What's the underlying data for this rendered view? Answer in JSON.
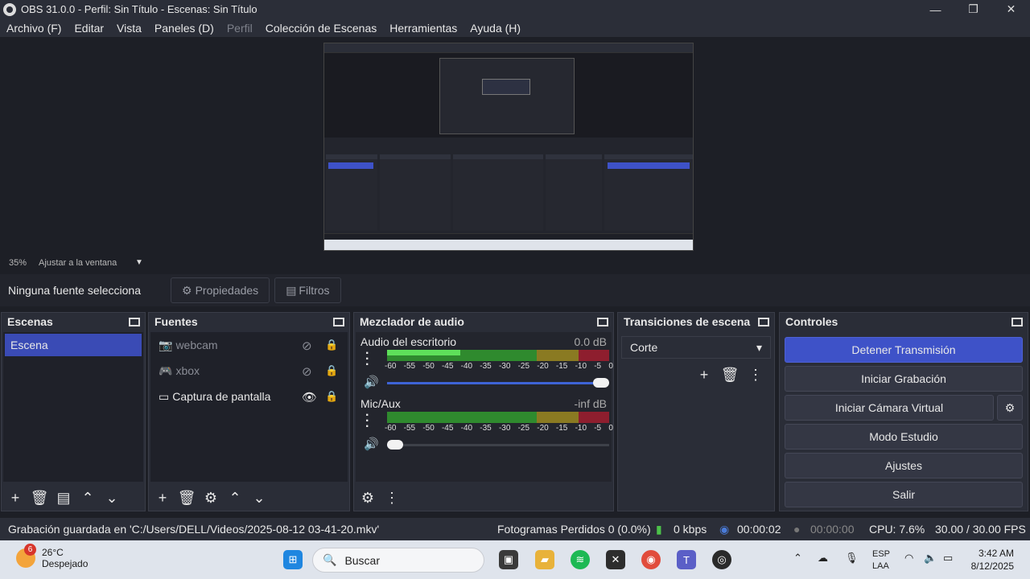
{
  "window": {
    "title": "OBS 31.0.0 - Perfil: Sin Título - Escenas: Sin Título",
    "min": "—",
    "max": "❐",
    "close": "✕"
  },
  "menu": [
    "Archivo (F)",
    "Editar",
    "Vista",
    "Paneles (D)",
    "Perfil",
    "Colección de Escenas",
    "Herramientas",
    "Ayuda (H)"
  ],
  "zoom": {
    "percent": "35%",
    "fit_label": "Ajustar a la ventana"
  },
  "selection": {
    "none_label": "Ninguna fuente selecciona",
    "properties": "Propiedades",
    "filters": "Filtros"
  },
  "scenes": {
    "title": "Escenas",
    "items": [
      "Escena"
    ]
  },
  "sources": {
    "title": "Fuentes",
    "items": [
      {
        "name": "webcam",
        "visible": false
      },
      {
        "name": "xbox",
        "visible": false
      },
      {
        "name": "Captura de pantalla",
        "visible": true
      }
    ]
  },
  "mixer": {
    "title": "Mezclador de audio",
    "channels": [
      {
        "name": "Audio del escritorio",
        "db": "0.0 dB",
        "level": 0.33,
        "volume": 0.97
      },
      {
        "name": "Mic/Aux",
        "db": "-inf dB",
        "level": 0,
        "volume": 0.03
      }
    ],
    "ticks": [
      "-60",
      "-55",
      "-50",
      "-45",
      "-40",
      "-35",
      "-30",
      "-25",
      "-20",
      "-15",
      "-10",
      "-5",
      "0"
    ]
  },
  "transitions": {
    "title": "Transiciones de escena",
    "selected": "Corte"
  },
  "controls": {
    "title": "Controles",
    "buttons": [
      "Detener Transmisión",
      "Iniciar Grabación",
      "Iniciar Cámara Virtual",
      "Modo Estudio",
      "Ajustes",
      "Salir"
    ]
  },
  "status": {
    "recording_saved": "Grabación guardada en 'C:/Users/DELL/Videos/2025-08-12 03-41-20.mkv'",
    "dropped": "Fotogramas Perdidos 0 (0.0%)",
    "bitrate": "0 kbps",
    "stream_time": "00:00:02",
    "rec_time": "00:00:00",
    "cpu": "CPU: 7.6%",
    "fps": "30.00 / 30.00 FPS"
  },
  "taskbar": {
    "weather_temp": "26°C",
    "weather_desc": "Despejado",
    "badge": "6",
    "search_placeholder": "Buscar",
    "lang_top": "ESP",
    "lang_bottom": "LAA",
    "time": "3:42 AM",
    "date": "8/12/2025"
  },
  "colors": {
    "accent": "#3e52c8",
    "meter_green": "#5ee05a"
  }
}
